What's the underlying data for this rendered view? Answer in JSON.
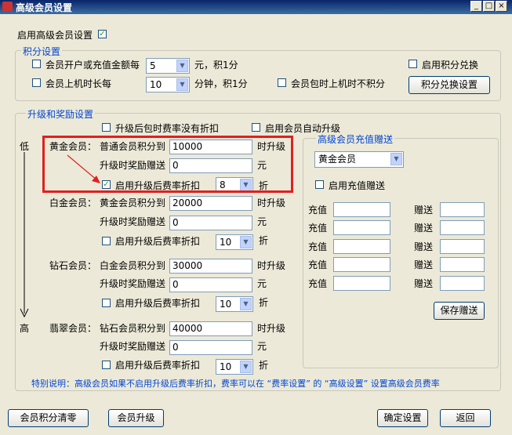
{
  "window": {
    "title": "高级会员设置"
  },
  "enable_vip": {
    "label": "启用高级会员设置",
    "checked": true
  },
  "points": {
    "group_label": "积分设置",
    "row1": {
      "label": "会员开户或充值金额每",
      "value": "5",
      "suffix": "元，积1分",
      "checked": false
    },
    "row2": {
      "label": "会员上机时长每",
      "value": "10",
      "suffix": "分钟，积1分",
      "checked": false
    },
    "no_points_label": "会员包时上机时不积分",
    "enable_exchange_label": "启用积分兑换",
    "exchange_button": "积分兑换设置"
  },
  "upgrade": {
    "group_label": "升级和奖励设置",
    "no_discount_label": "升级后包时费率没有折扣",
    "auto_upgrade_label": "启用会员自动升级",
    "low_label": "低",
    "high_label": "高",
    "levels": [
      {
        "name": "黄金会员：",
        "req_label": "普通会员积分到",
        "req_value": "10000",
        "req_suffix": "时升级",
        "reward_label": "升级时奖励赠送",
        "reward_value": "0",
        "reward_suffix": "元",
        "discount_label": "启用升级后费率折扣",
        "discount_value": "8",
        "discount_suffix": "折",
        "discount_checked": true
      },
      {
        "name": "白金会员：",
        "req_label": "黄金会员积分到",
        "req_value": "20000",
        "req_suffix": "时升级",
        "reward_label": "升级时奖励赠送",
        "reward_value": "0",
        "reward_suffix": "元",
        "discount_label": "启用升级后费率折扣",
        "discount_value": "10",
        "discount_suffix": "折",
        "discount_checked": false
      },
      {
        "name": "钻石会员：",
        "req_label": "白金会员积分到",
        "req_value": "30000",
        "req_suffix": "时升级",
        "reward_label": "升级时奖励赠送",
        "reward_value": "0",
        "reward_suffix": "元",
        "discount_label": "启用升级后费率折扣",
        "discount_value": "10",
        "discount_suffix": "折",
        "discount_checked": false
      },
      {
        "name": "翡翠会员：",
        "req_label": "钻石会员积分到",
        "req_value": "40000",
        "req_suffix": "时升级",
        "reward_label": "升级时奖励赠送",
        "reward_value": "0",
        "reward_suffix": "元",
        "discount_label": "启用升级后费率折扣",
        "discount_value": "10",
        "discount_suffix": "折",
        "discount_checked": false
      }
    ]
  },
  "recharge": {
    "group_label": "高级会员充值赠送",
    "member_select": "黄金会员",
    "enable_label": "启用充值赠送",
    "recharge_label": "充值",
    "gift_label": "赠送",
    "rows": [
      {
        "recharge": "",
        "gift": ""
      },
      {
        "recharge": "",
        "gift": ""
      },
      {
        "recharge": "",
        "gift": ""
      },
      {
        "recharge": "",
        "gift": ""
      },
      {
        "recharge": "",
        "gift": ""
      }
    ],
    "save_button": "保存赠送"
  },
  "note": "特别说明：高级会员如果不启用升级后费率折扣，费率可以在 “费率设置” 的 “高级设置” 设置高级会员费率",
  "footer": {
    "clear_points": "会员积分清零",
    "upgrade": "会员升级",
    "confirm": "确定设置",
    "back": "返回"
  },
  "colors": {
    "highlight_box": "#e02020",
    "arrow": "#e02020",
    "group_label": "#0046d5"
  }
}
